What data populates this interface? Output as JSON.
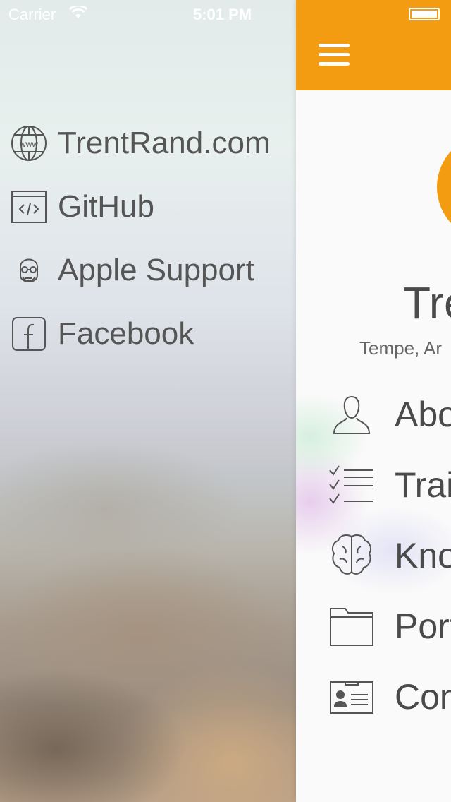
{
  "status_bar": {
    "carrier": "Carrier",
    "time": "5:01 PM"
  },
  "side_menu": {
    "items": [
      {
        "label": "TrentRand.com",
        "icon": "globe-www-icon"
      },
      {
        "label": "GitHub",
        "icon": "code-window-icon"
      },
      {
        "label": "Apple Support",
        "icon": "steve-jobs-icon"
      },
      {
        "label": "Facebook",
        "icon": "facebook-icon"
      }
    ]
  },
  "main": {
    "accent_color": "#f39c12",
    "profile": {
      "name": "Tre",
      "location": "Tempe, Ar"
    },
    "nav_items": [
      {
        "label": "Abo",
        "icon": "person-icon"
      },
      {
        "label": "Trait",
        "icon": "checklist-icon"
      },
      {
        "label": "Kno",
        "icon": "brain-icon"
      },
      {
        "label": "Port",
        "icon": "folder-icon"
      },
      {
        "label": "Con",
        "icon": "contact-card-icon"
      }
    ]
  }
}
